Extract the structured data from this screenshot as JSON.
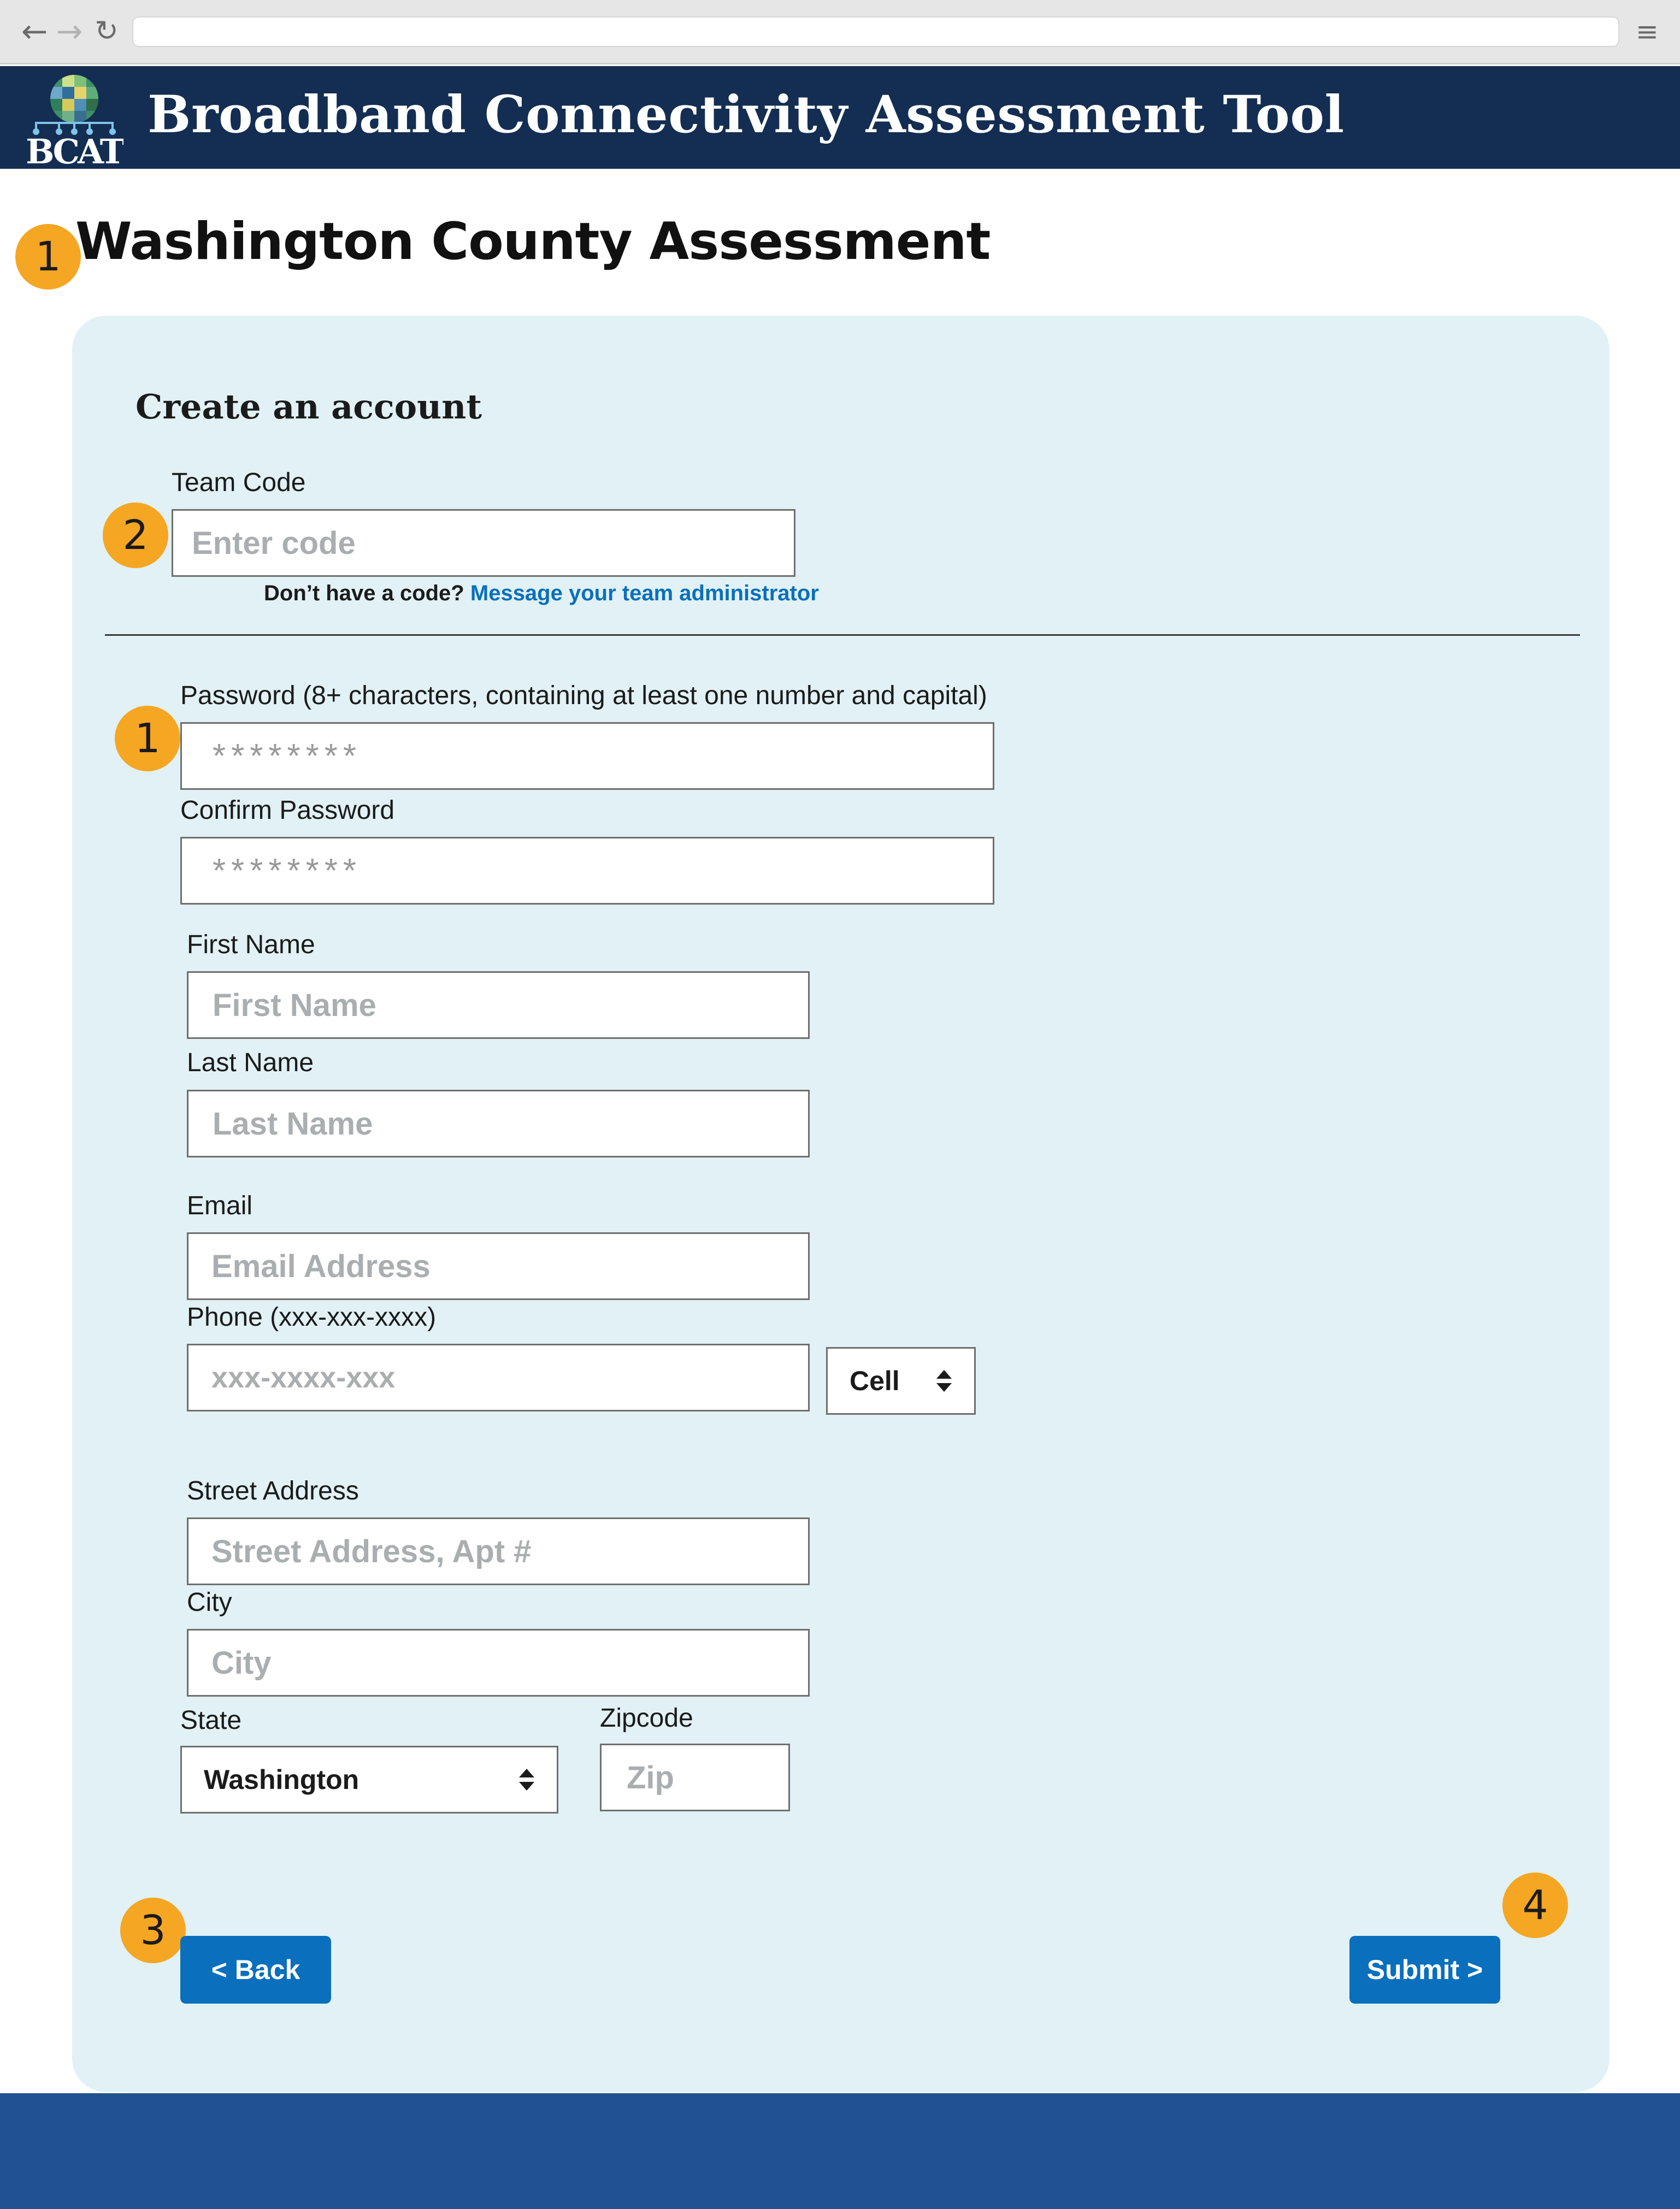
{
  "header": {
    "logo_text": "BCAT",
    "title": "Broadband Connectivity Assessment Tool"
  },
  "page_title": "Washington County Assessment",
  "form": {
    "heading": "Create an account",
    "team_code": {
      "label": "Team Code",
      "placeholder": "Enter code"
    },
    "code_help": {
      "text": "Don’t have a code?",
      "link": "Message your team administrator"
    },
    "password": {
      "label": "Password (8+ characters, containing at least one number and capital)",
      "value": "********"
    },
    "confirm_password": {
      "label": "Confirm Password",
      "value": "********"
    },
    "first_name": {
      "label": "First Name",
      "placeholder": "First Name"
    },
    "last_name": {
      "label": "Last Name",
      "placeholder": "Last Name"
    },
    "email": {
      "label": "Email",
      "placeholder": "Email Address"
    },
    "phone": {
      "label": "Phone (xxx-xxx-xxxx)",
      "placeholder": "xxx-xxxx-xxx",
      "type_selected": "Cell"
    },
    "street": {
      "label": "Street Address",
      "placeholder": "Street Address, Apt #"
    },
    "city": {
      "label": "City",
      "placeholder": "City"
    },
    "state": {
      "label": "State",
      "selected": "Washington"
    },
    "zip": {
      "label": "Zipcode",
      "placeholder": "Zip"
    },
    "back_label": "< Back",
    "submit_label": "Submit >"
  },
  "annotations": {
    "title_badge": "1",
    "team_code_badge": "2",
    "password_badge": "1",
    "back_badge": "3",
    "submit_badge": "4"
  },
  "colors": {
    "header_bg": "#132e52",
    "card_bg": "#e1f1f5",
    "button": "#0a6fbd",
    "badge": "#f5a623",
    "footer_bg": "#215190"
  }
}
